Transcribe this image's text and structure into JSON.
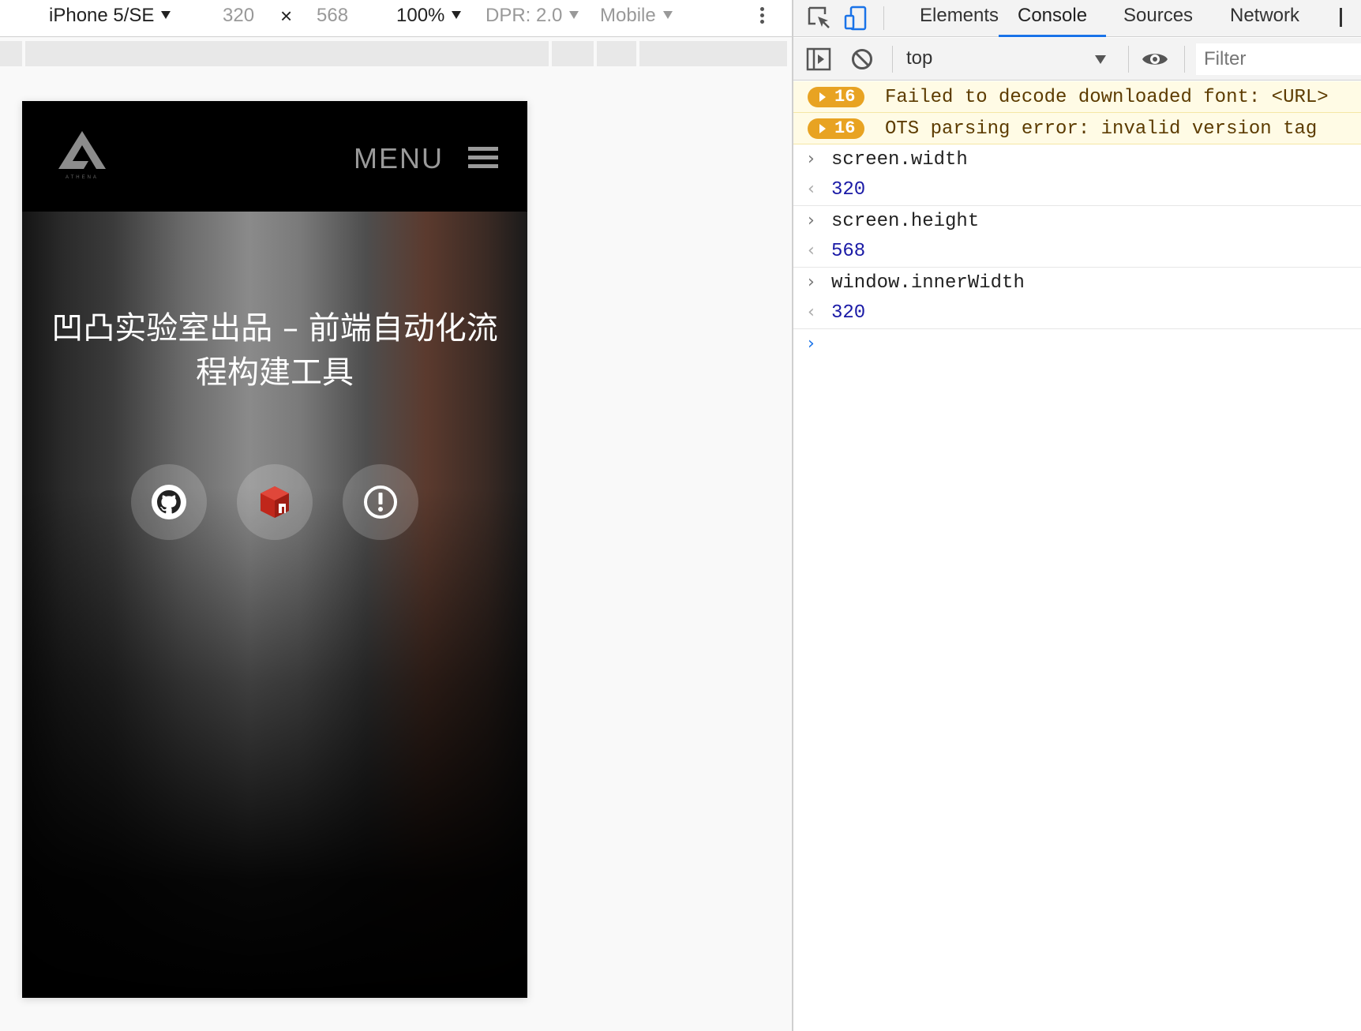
{
  "device_toolbar": {
    "device": "iPhone 5/SE",
    "width": "320",
    "times": "×",
    "height": "568",
    "zoom": "100%",
    "dpr": "DPR: 2.0",
    "mode": "Mobile"
  },
  "site": {
    "menu_label": "MENU",
    "logo_text": "ATHENA",
    "hero_title": "凹凸实验室出品 – 前端自动化流程构建工具",
    "icons": [
      "github-icon",
      "npm-cube-icon",
      "issues-icon"
    ]
  },
  "devtools": {
    "tabs": [
      "Elements",
      "Console",
      "Sources",
      "Network"
    ],
    "active_tab": "Console",
    "context": "top",
    "filter_placeholder": "Filter",
    "warnings": [
      {
        "count": "16",
        "message": "Failed to decode downloaded font: <URL>"
      },
      {
        "count": "16",
        "message": "OTS parsing error: invalid version tag"
      }
    ],
    "entries": [
      {
        "command": "screen.width",
        "result": "320"
      },
      {
        "command": "screen.height",
        "result": "568"
      },
      {
        "command": "window.innerWidth",
        "result": "320"
      }
    ],
    "colors": {
      "accent": "#1a73e8",
      "warning_badge": "#e8a322",
      "result_number": "#1a1aa6"
    }
  }
}
